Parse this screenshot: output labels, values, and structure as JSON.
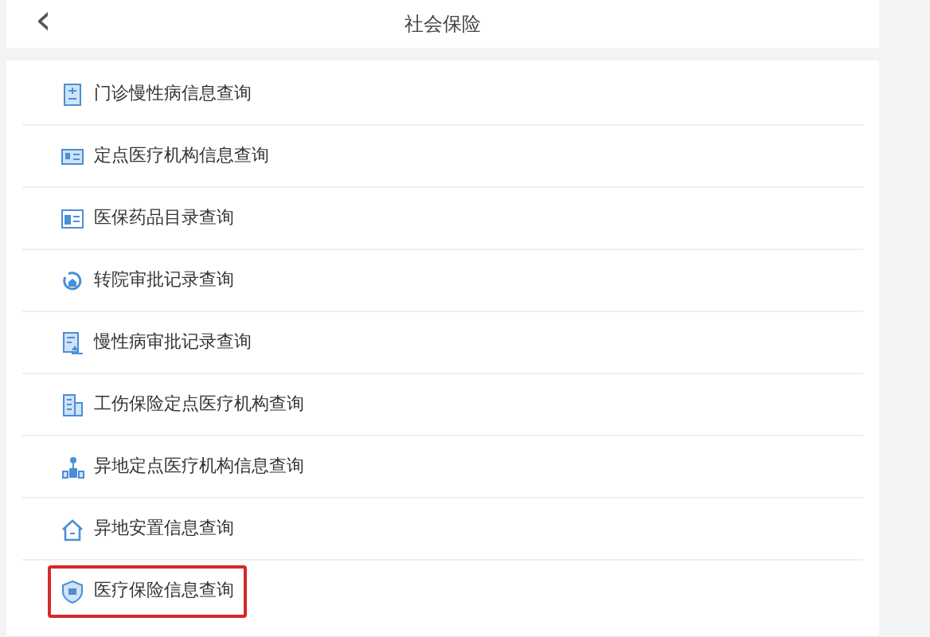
{
  "header": {
    "back": "‹",
    "title": "社会保险"
  },
  "items": [
    {
      "label": "门诊慢性病信息查询",
      "highlighted": false
    },
    {
      "label": "定点医疗机构信息查询",
      "highlighted": false
    },
    {
      "label": "医保药品目录查询",
      "highlighted": false
    },
    {
      "label": "转院审批记录查询",
      "highlighted": false
    },
    {
      "label": "慢性病审批记录查询",
      "highlighted": false
    },
    {
      "label": "工伤保险定点医疗机构查询",
      "highlighted": false
    },
    {
      "label": "异地定点医疗机构信息查询",
      "highlighted": false
    },
    {
      "label": "异地安置信息查询",
      "highlighted": false
    },
    {
      "label": "医疗保险信息查询",
      "highlighted": true
    }
  ]
}
